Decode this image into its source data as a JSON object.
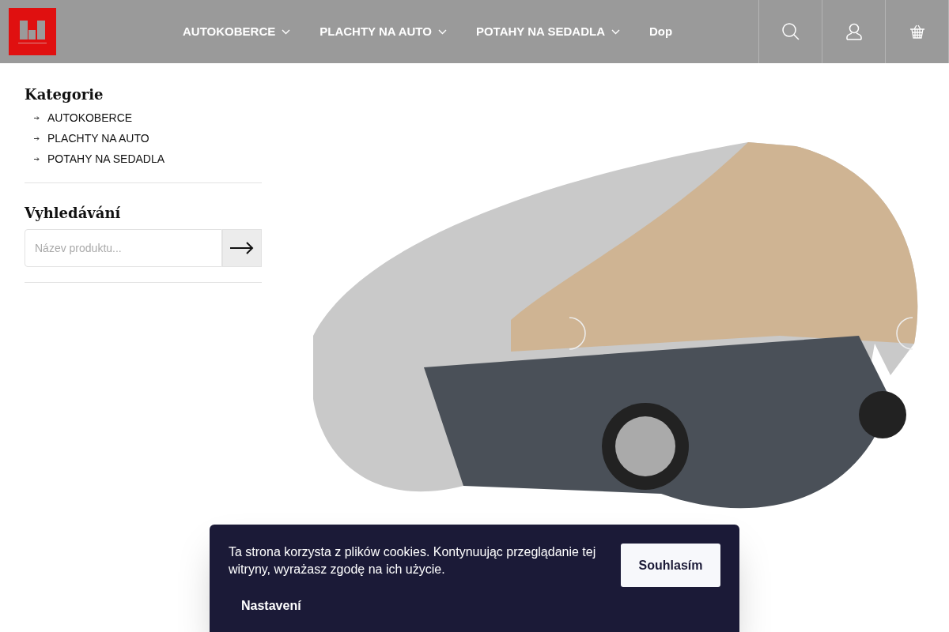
{
  "header": {
    "nav": [
      {
        "label": "AUTOKOBERCE",
        "dropdown": true
      },
      {
        "label": "PLACHTY NA AUTO",
        "dropdown": true
      },
      {
        "label": "POTAHY NA SEDADLA",
        "dropdown": true
      },
      {
        "label": "Dop",
        "dropdown": false
      }
    ]
  },
  "sidebar": {
    "categories_title": "Kategorie",
    "categories": [
      "AUTOKOBERCE",
      "PLACHTY NA AUTO",
      "POTAHY NA SEDADLA"
    ],
    "search_title": "Vyhledávání",
    "search": {
      "placeholder": "Název produktu..."
    }
  },
  "cookie_banner": {
    "message": "Ta strona korzysta z plików cookies. Kontynuując przeglądanie tej witryny, wyrażasz zgodę na ich użycie.",
    "accept": "Souhlasím",
    "settings": "Nastavení"
  }
}
